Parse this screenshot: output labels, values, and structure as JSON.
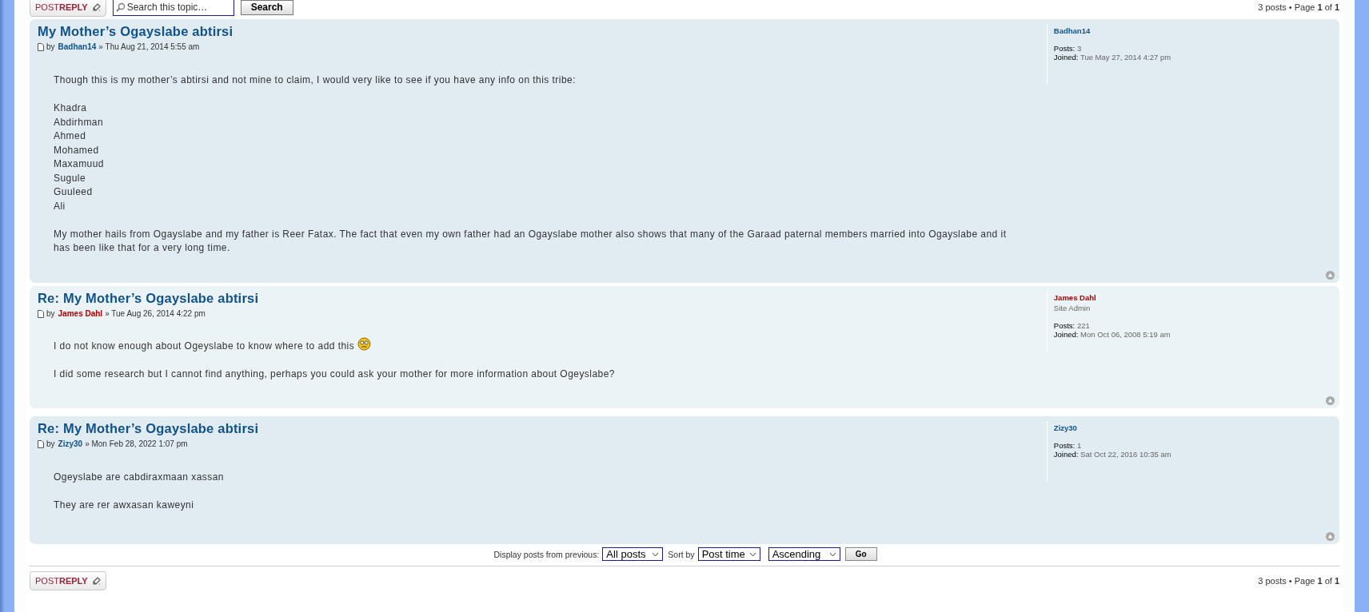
{
  "top_bar": {
    "reply_button": {
      "normal": "POST",
      "bold": "REPLY"
    },
    "search": {
      "placeholder": "Search this topic…"
    },
    "search_button": "Search",
    "pagination": "3 posts • Page **1** of **1**"
  },
  "posts": [
    {
      "title": "My Mother’s Ogayslabe abtirsi",
      "by": "by",
      "author": "Badhan14",
      "color": "#105289",
      "date": "» Thu Aug 21, 2014 5:55 am",
      "body": [
        {
          "kind": "text",
          "lines": [
            "Though this is my mother’s abtirsi and not mine to claim, I would very like to see if you have any info on this tribe:"
          ]
        },
        {
          "kind": "text",
          "lines": [
            "Khadra",
            "Abdirhman",
            "Ahmed",
            "Mohamed",
            "Maxamuud",
            "Sugule",
            "Guuleed",
            "Ali"
          ]
        },
        {
          "kind": "text",
          "lines": [
            "My mother hails from Ogayslabe and my father is Reer Fatax. The fact that even my own father had an Ogayslabe mother also shows that many of the Garaad paternal members married into Ogayslabe and it has been like that for a very long time."
          ]
        }
      ],
      "profile": {
        "name": "Badhan14",
        "posts_label": "Posts:",
        "posts": "3",
        "joined_label": "Joined:",
        "joined": "Tue May 27, 2014 4:27 pm"
      }
    },
    {
      "title": "Re: My Mother’s Ogayslabe abtirsi",
      "by": "by",
      "author": "James Dahl",
      "color": "#aa0000",
      "date": "» Tue Aug 26, 2014 4:22 pm",
      "body": [
        {
          "kind": "smiley",
          "lines": [
            "I do not know enough about Ogeyslabe to know where to add this"
          ]
        },
        {
          "kind": "text",
          "lines": [
            "I did some research but I cannot find anything, perhaps you could ask your mother for more information about Ogeyslabe?"
          ]
        }
      ],
      "profile": {
        "name": "James Dahl",
        "rank": "Site Admin",
        "posts_label": "Posts:",
        "posts": "221",
        "joined_label": "Joined:",
        "joined": "Mon Oct 06, 2008 5:19 am"
      }
    },
    {
      "title": "Re: My Mother’s Ogayslabe abtirsi",
      "by": "by",
      "author": "Zizy30",
      "color": "#105289",
      "date": "» Mon Feb 28, 2022 1:07 pm",
      "body": [
        {
          "kind": "text",
          "lines": [
            "Ogeyslabe are cabdiraxmaan xassan"
          ]
        },
        {
          "kind": "spaced",
          "lines": [
            "They are rer awxasan kaweyni"
          ]
        }
      ],
      "profile": {
        "name": "Zizy30",
        "posts_label": "Posts:",
        "posts": "1",
        "joined_label": "Joined:",
        "joined": "Sat Oct 22, 2016 10:35 am"
      }
    }
  ],
  "sort_bar": {
    "display_label": "Display posts from previous:",
    "display_value": "All posts",
    "sort_label": "Sort by",
    "sort_value": "Post time",
    "order_value": "Ascending",
    "go_button": "Go"
  },
  "bottom_bar": {
    "reply_button": {
      "normal": "POST",
      "bold": "REPLY"
    },
    "pagination": "3 posts • Page **1** of **1**"
  }
}
